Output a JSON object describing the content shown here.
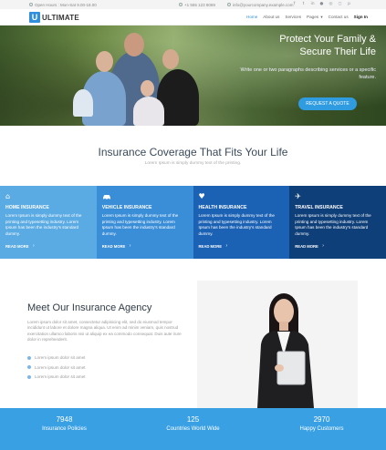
{
  "topbar": {
    "hours": "Open Hours : Mon-Sat 9.00-18.00",
    "phone": "+1 555 123 8069",
    "email": "info@yourcompany.example.com",
    "social_icons": [
      "facebook-icon",
      "twitter-icon",
      "linkedin-icon",
      "flickr-icon",
      "dribbble-icon",
      "instagram-icon",
      "pinterest-icon"
    ]
  },
  "nav": {
    "logo_letter": "U",
    "logo_text": "ULTIMATE",
    "menu": [
      "Home",
      "About us",
      "Services",
      "Pages",
      "Contact us",
      "Sign In"
    ]
  },
  "hero": {
    "title": "Protect Your Family & Secure Their Life",
    "text": "Write one or two paragraphs describing services or a specific feature.",
    "cta": "REQUEST A QUOTE"
  },
  "coverage": {
    "title": "Insurance Coverage That Fits Your Life",
    "subtitle": "Lorem Ipsum is simply dummy text of the printing."
  },
  "cards": [
    {
      "icon": "home-icon",
      "glyph": "⌂",
      "title": "HOME INSURANCE",
      "text": "Lorem Ipsum is simply dummy text of the printing and typesetting industry. Lorem Ipsum has been the industry's standard dummy.",
      "more": "READ MORE",
      "color": "#5aaae3"
    },
    {
      "icon": "car-icon",
      "glyph": "🚗",
      "title": "VEHICLE INSURANCE",
      "text": "Lorem Ipsum is simply dummy text of the printing and typesetting industry. Lorem Ipsum has been the industry's standard dummy.",
      "more": "READ MORE",
      "color": "#3a8ed8"
    },
    {
      "icon": "heart-icon",
      "glyph": "♥",
      "title": "HEALTH INSURANCE",
      "text": "Lorem Ipsum is simply dummy text of the printing and typesetting industry. Lorem Ipsum has been the industry's standard dummy.",
      "more": "READ MORE",
      "color": "#1c62b4"
    },
    {
      "icon": "airplane-icon",
      "glyph": "✈",
      "title": "TRAVEL INSURANCE",
      "text": "Lorem Ipsum is simply dummy text of the printing and typesetting industry. Lorem Ipsum has been the industry's standard dummy.",
      "more": "READ MORE",
      "color": "#0f3f78"
    }
  ],
  "agency": {
    "title": "Meet Our Insurance Agency",
    "text": "Lorem ipsum dolor sit amet, consectetur adipisicing elit, sed do eiusmod tempor incididunt ut labore et dolore magna aliqua. Ut enim ad minim veniam, quis nostrud exercitation ullamco laboris nisi ut aliquip ex ea commodo consequat. Duis aute irure dolor in reprehenderit.",
    "bullets": [
      "Lorem ipsum dolor sit amet",
      "Lorem ipsum dolor sit amet",
      "Lorem ipsum dolor sit amet"
    ]
  },
  "stats": [
    {
      "num": "7948",
      "label": "Insurance Policies"
    },
    {
      "num": "125",
      "label": "Countries World Wide"
    },
    {
      "num": "2970",
      "label": "Happy Customers"
    }
  ]
}
